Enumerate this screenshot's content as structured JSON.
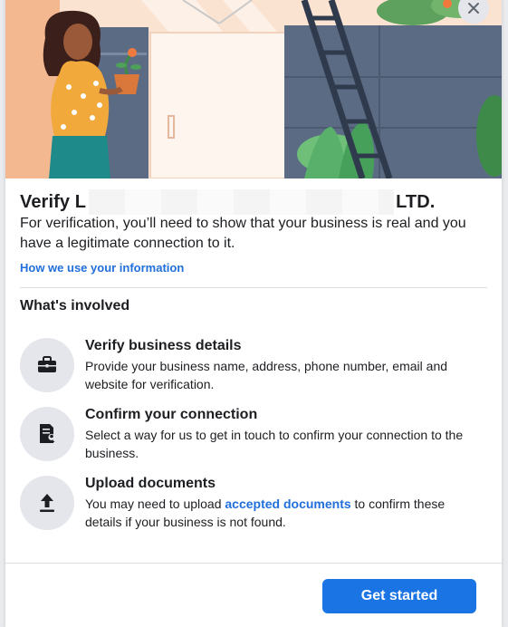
{
  "dialog": {
    "title_prefix": "Verify L",
    "title_suffix": "LTD.",
    "subtitle": "For verification, you’ll need to show that your business is real and you have a legitimate connection to it.",
    "info_link": "How we use your information",
    "section_title": "What's involved",
    "steps": [
      {
        "title": "Verify business details",
        "desc": "Provide your business name, address, phone number, email and website for verification.",
        "icon": "briefcase-icon"
      },
      {
        "title": "Confirm your connection",
        "desc": "Select a way for us to get in touch to confirm your connection to the business.",
        "icon": "document-person-icon"
      },
      {
        "title": "Upload documents",
        "desc_before": "You may need to upload ",
        "desc_link": "accepted documents",
        "desc_after": " to confirm these details if your business is not found.",
        "icon": "upload-icon"
      }
    ],
    "cta_label": "Get started"
  },
  "colors": {
    "primary": "#1b74e4",
    "link": "#216fdb",
    "icon_bg": "#e4e6eb",
    "hero_peach": "#fbe6d6",
    "hero_slate": "#5b6b83"
  }
}
